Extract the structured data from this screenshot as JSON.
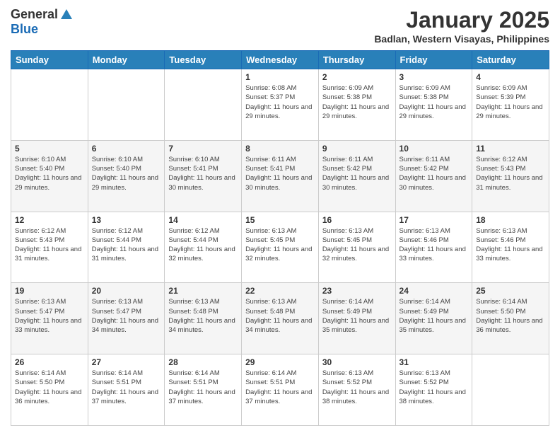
{
  "logo": {
    "general": "General",
    "blue": "Blue"
  },
  "title": "January 2025",
  "subtitle": "Badlan, Western Visayas, Philippines",
  "days_header": [
    "Sunday",
    "Monday",
    "Tuesday",
    "Wednesday",
    "Thursday",
    "Friday",
    "Saturday"
  ],
  "weeks": [
    [
      {
        "day": "",
        "info": ""
      },
      {
        "day": "",
        "info": ""
      },
      {
        "day": "",
        "info": ""
      },
      {
        "day": "1",
        "info": "Sunrise: 6:08 AM\nSunset: 5:37 PM\nDaylight: 11 hours and 29 minutes."
      },
      {
        "day": "2",
        "info": "Sunrise: 6:09 AM\nSunset: 5:38 PM\nDaylight: 11 hours and 29 minutes."
      },
      {
        "day": "3",
        "info": "Sunrise: 6:09 AM\nSunset: 5:38 PM\nDaylight: 11 hours and 29 minutes."
      },
      {
        "day": "4",
        "info": "Sunrise: 6:09 AM\nSunset: 5:39 PM\nDaylight: 11 hours and 29 minutes."
      }
    ],
    [
      {
        "day": "5",
        "info": "Sunrise: 6:10 AM\nSunset: 5:40 PM\nDaylight: 11 hours and 29 minutes."
      },
      {
        "day": "6",
        "info": "Sunrise: 6:10 AM\nSunset: 5:40 PM\nDaylight: 11 hours and 29 minutes."
      },
      {
        "day": "7",
        "info": "Sunrise: 6:10 AM\nSunset: 5:41 PM\nDaylight: 11 hours and 30 minutes."
      },
      {
        "day": "8",
        "info": "Sunrise: 6:11 AM\nSunset: 5:41 PM\nDaylight: 11 hours and 30 minutes."
      },
      {
        "day": "9",
        "info": "Sunrise: 6:11 AM\nSunset: 5:42 PM\nDaylight: 11 hours and 30 minutes."
      },
      {
        "day": "10",
        "info": "Sunrise: 6:11 AM\nSunset: 5:42 PM\nDaylight: 11 hours and 30 minutes."
      },
      {
        "day": "11",
        "info": "Sunrise: 6:12 AM\nSunset: 5:43 PM\nDaylight: 11 hours and 31 minutes."
      }
    ],
    [
      {
        "day": "12",
        "info": "Sunrise: 6:12 AM\nSunset: 5:43 PM\nDaylight: 11 hours and 31 minutes."
      },
      {
        "day": "13",
        "info": "Sunrise: 6:12 AM\nSunset: 5:44 PM\nDaylight: 11 hours and 31 minutes."
      },
      {
        "day": "14",
        "info": "Sunrise: 6:12 AM\nSunset: 5:44 PM\nDaylight: 11 hours and 32 minutes."
      },
      {
        "day": "15",
        "info": "Sunrise: 6:13 AM\nSunset: 5:45 PM\nDaylight: 11 hours and 32 minutes."
      },
      {
        "day": "16",
        "info": "Sunrise: 6:13 AM\nSunset: 5:45 PM\nDaylight: 11 hours and 32 minutes."
      },
      {
        "day": "17",
        "info": "Sunrise: 6:13 AM\nSunset: 5:46 PM\nDaylight: 11 hours and 33 minutes."
      },
      {
        "day": "18",
        "info": "Sunrise: 6:13 AM\nSunset: 5:46 PM\nDaylight: 11 hours and 33 minutes."
      }
    ],
    [
      {
        "day": "19",
        "info": "Sunrise: 6:13 AM\nSunset: 5:47 PM\nDaylight: 11 hours and 33 minutes."
      },
      {
        "day": "20",
        "info": "Sunrise: 6:13 AM\nSunset: 5:47 PM\nDaylight: 11 hours and 34 minutes."
      },
      {
        "day": "21",
        "info": "Sunrise: 6:13 AM\nSunset: 5:48 PM\nDaylight: 11 hours and 34 minutes."
      },
      {
        "day": "22",
        "info": "Sunrise: 6:13 AM\nSunset: 5:48 PM\nDaylight: 11 hours and 34 minutes."
      },
      {
        "day": "23",
        "info": "Sunrise: 6:14 AM\nSunset: 5:49 PM\nDaylight: 11 hours and 35 minutes."
      },
      {
        "day": "24",
        "info": "Sunrise: 6:14 AM\nSunset: 5:49 PM\nDaylight: 11 hours and 35 minutes."
      },
      {
        "day": "25",
        "info": "Sunrise: 6:14 AM\nSunset: 5:50 PM\nDaylight: 11 hours and 36 minutes."
      }
    ],
    [
      {
        "day": "26",
        "info": "Sunrise: 6:14 AM\nSunset: 5:50 PM\nDaylight: 11 hours and 36 minutes."
      },
      {
        "day": "27",
        "info": "Sunrise: 6:14 AM\nSunset: 5:51 PM\nDaylight: 11 hours and 37 minutes."
      },
      {
        "day": "28",
        "info": "Sunrise: 6:14 AM\nSunset: 5:51 PM\nDaylight: 11 hours and 37 minutes."
      },
      {
        "day": "29",
        "info": "Sunrise: 6:14 AM\nSunset: 5:51 PM\nDaylight: 11 hours and 37 minutes."
      },
      {
        "day": "30",
        "info": "Sunrise: 6:13 AM\nSunset: 5:52 PM\nDaylight: 11 hours and 38 minutes."
      },
      {
        "day": "31",
        "info": "Sunrise: 6:13 AM\nSunset: 5:52 PM\nDaylight: 11 hours and 38 minutes."
      },
      {
        "day": "",
        "info": ""
      }
    ]
  ]
}
